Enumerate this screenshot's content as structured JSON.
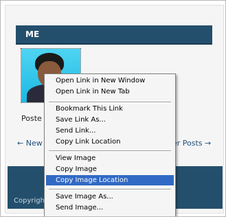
{
  "page": {
    "section_title": "ME",
    "posted_label": "Poste",
    "nav": {
      "prev_label": "← New",
      "next_label": "der Posts →"
    },
    "footer_text": "Copyrigh"
  },
  "context_menu": {
    "items": [
      {
        "label": "Open Link in New Window",
        "highlighted": false
      },
      {
        "label": "Open Link in New Tab",
        "highlighted": false
      },
      {
        "label": "Bookmark This Link",
        "highlighted": false
      },
      {
        "label": "Save Link As...",
        "highlighted": false
      },
      {
        "label": "Send Link...",
        "highlighted": false
      },
      {
        "label": "Copy Link Location",
        "highlighted": false
      },
      {
        "label": "View Image",
        "highlighted": false
      },
      {
        "label": "Copy Image",
        "highlighted": false
      },
      {
        "label": "Copy Image Location",
        "highlighted": true
      },
      {
        "label": "Save Image As...",
        "highlighted": false
      },
      {
        "label": "Send Image...",
        "highlighted": false
      }
    ]
  },
  "colors": {
    "header": "#244f6c",
    "highlight": "#316ac5",
    "avatar_bg": "#18c4ee"
  }
}
